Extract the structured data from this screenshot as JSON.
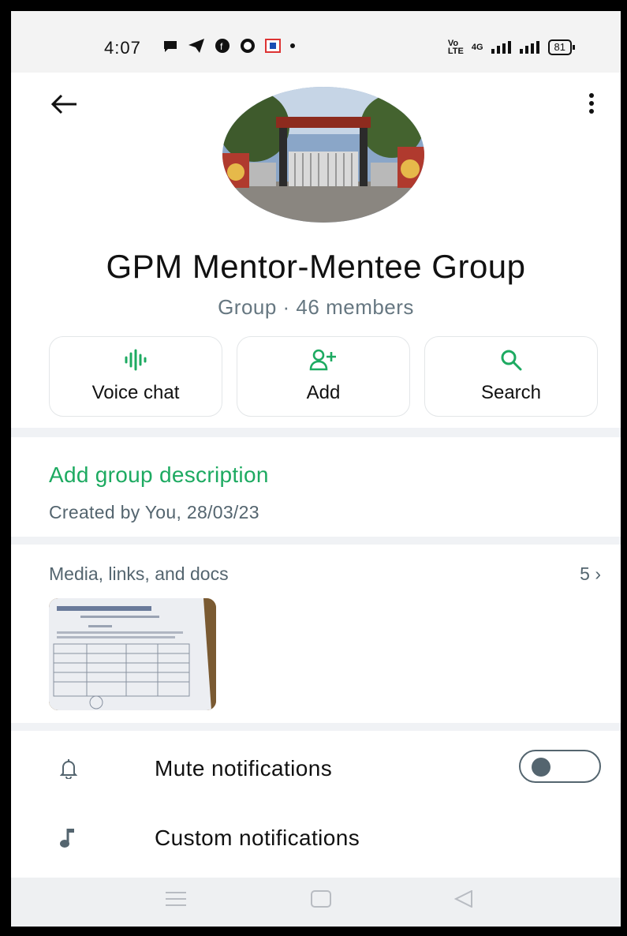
{
  "status_bar": {
    "time": "4:07",
    "battery": "81",
    "network_label": "4G"
  },
  "group": {
    "name": "GPM Mentor-Mentee Group",
    "subtitle": "Group · 46 members"
  },
  "actions": [
    {
      "label": "Voice chat",
      "icon": "voice-waveform-icon"
    },
    {
      "label": "Add",
      "icon": "add-person-icon"
    },
    {
      "label": "Search",
      "icon": "search-icon"
    }
  ],
  "description": {
    "add_label": "Add group description",
    "created": "Created by You, 28/03/23"
  },
  "media": {
    "title": "Media, links, and docs",
    "count": "5 ›"
  },
  "settings": [
    {
      "label": "Mute notifications",
      "icon": "bell-icon"
    },
    {
      "label": "Custom notifications",
      "icon": "music-note-icon"
    }
  ],
  "colors": {
    "accent": "#1daa61",
    "muted_text": "#667781"
  }
}
